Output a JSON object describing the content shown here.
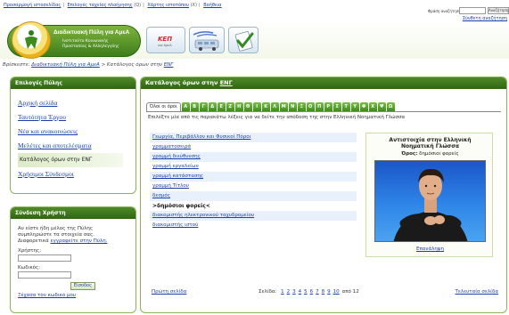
{
  "topbar": {
    "links": [
      "Προσαρμογή ιστοσελίδας",
      "Επιλογές ταχείας πλοήγησης",
      "Χάρτης ιστοτόπου",
      "Βοήθεια"
    ],
    "keys": [
      "",
      "(Q)",
      "(X)",
      ""
    ]
  },
  "search": {
    "label": "Φράση αναζήτησης",
    "button": "Αναζήτηση",
    "advanced": "Σύνθετη αναζήτηση"
  },
  "header": {
    "logo_title": "Διαδικτυακή Πύλη για ΑμεΑ",
    "logo_sub1": "Ινστιτούτο Κοινωνικής",
    "logo_sub2": "Προστασίας & Αλληλεγγύης",
    "kep_label": "ΚΕΠ",
    "kep_sub": "για ΑμεΑ"
  },
  "breadcrumb": {
    "prefix": "Βρίσκεστε:",
    "home": "Διαδικτυακή Πύλη για ΑμεΑ",
    "separator": ">",
    "current_prefix": "Κατάλογος όρων στην",
    "current_link": "ΕΝΓ"
  },
  "nav": {
    "title": "Επιλογές Πύλης",
    "items": [
      {
        "label": "Αρχική σελίδα",
        "active": false
      },
      {
        "label": "Ταυτότητα Έργου",
        "active": false
      },
      {
        "label": "Νέα και ανακοινώσεις",
        "active": false
      },
      {
        "label": "Μελέτες και αποτελέσματα",
        "active": false
      },
      {
        "label": "Κατάλογος όρων στην ΕΝΓ",
        "active": true
      },
      {
        "label": "Χρήσιμοι Σύνδεσμοι",
        "active": false
      }
    ]
  },
  "login": {
    "title": "Σύνδεση Χρήστη",
    "intro_1": "Αν είστε ήδη μέλος της Πύλης",
    "intro_2": "συμπληρώστε τα στοιχεία σας.",
    "intro_3": "Διαφορετικά",
    "register_link": "εγγραφείτε στην Πύλη.",
    "username_label": "Χρήστης:",
    "password_label": "Κωδικός:",
    "submit": "Είσοδος",
    "forgot": "Ξέχασα τον κωδικό μου"
  },
  "main": {
    "title_prefix": "Κατάλογος όρων στην",
    "title_link": "ΕΝΓ",
    "all_terms": "Όλοι οι όροι",
    "letters": [
      "Α",
      "Β",
      "Γ",
      "Δ",
      "Ε",
      "Ζ",
      "Η",
      "Θ",
      "Ι",
      "Κ",
      "Λ",
      "Μ",
      "Ν",
      "Ξ",
      "Ο",
      "Π",
      "Ρ",
      "Σ",
      "Τ",
      "Υ",
      "Φ",
      "Χ",
      "Ψ",
      "Ω"
    ],
    "instruction": "Επιλέξτε μία από τις παρακάτω λέξεις για να δείτε την απόδοση της στην Ελληνική Νοηματική Γλώσσα",
    "terms": [
      {
        "label": "Γεωργία, Περιβάλλον και Φυσικοί Πόροι",
        "current": false
      },
      {
        "label": "γραμματοσειρά",
        "current": false
      },
      {
        "label": "γραμμή διεύθυνσης",
        "current": false
      },
      {
        "label": "γραμμή εργαλείων",
        "current": false
      },
      {
        "label": "γραμμή κατάστασης",
        "current": false
      },
      {
        "label": "γραμμή Τίτλου",
        "current": false
      },
      {
        "label": "δεσμός",
        "current": false
      },
      {
        "label": ">δημόσιοι φορείς<",
        "current": true
      },
      {
        "label": "διακομιστής ηλεκτρονικού ταχυδρομείου",
        "current": false
      },
      {
        "label": "διακομιστής ιστού",
        "current": false
      }
    ],
    "video": {
      "title_1": "Αντιστοιχία στην Ελληνική",
      "title_2": "Νοηματική Γλώσσα",
      "term_label": "Όρος:",
      "term_value": "δημόσιοι φορείς",
      "replay": "Επανάληψη"
    },
    "pager": {
      "first": "Πρώτη σελίδα",
      "label": "Σελίδα:",
      "pages": [
        "1",
        "2",
        "3",
        "4",
        "5",
        "6",
        "7",
        "8",
        "9",
        "10"
      ],
      "total": "από 12",
      "last": "Τελευταία σελίδα"
    }
  },
  "colors": {
    "brand_green": "#3d7d1c",
    "link_blue": "#1a3fa8",
    "video_blue": "#2f86e8"
  }
}
